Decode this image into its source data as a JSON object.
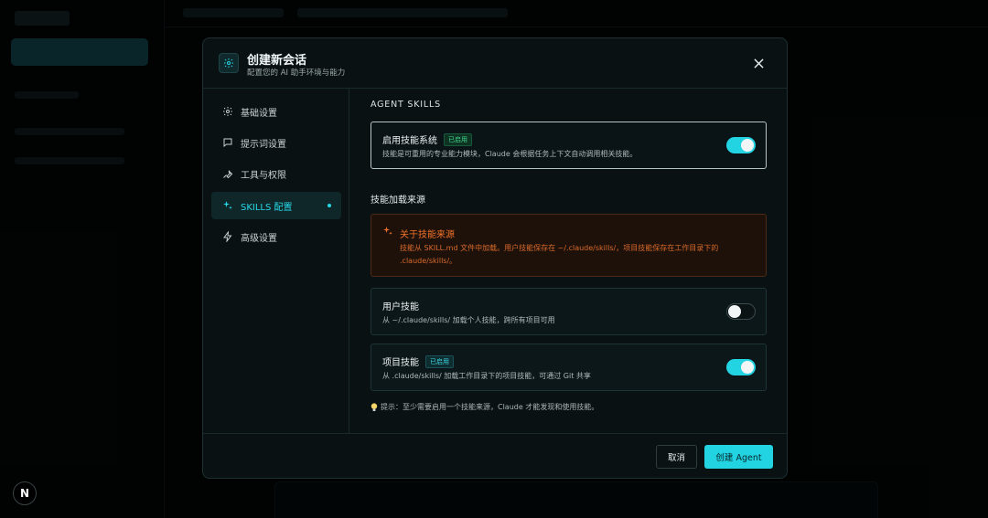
{
  "modal": {
    "title": "创建新会话",
    "subtitle": "配置您的 AI 助手环境与能力",
    "header_icon": "gear-icon",
    "close_icon": "close-icon"
  },
  "nav": {
    "items": [
      {
        "label": "基础设置",
        "icon": "gear-icon",
        "active": false
      },
      {
        "label": "提示词设置",
        "icon": "chat-bubble-icon",
        "active": false
      },
      {
        "label": "工具与权限",
        "icon": "wrench-icon",
        "active": false
      },
      {
        "label": "SKILLS 配置",
        "icon": "sparkles-icon",
        "active": true
      },
      {
        "label": "高级设置",
        "icon": "lightning-icon",
        "active": false
      }
    ]
  },
  "skills": {
    "section_title": "AGENT SKILLS",
    "enable_card": {
      "title": "启用技能系统",
      "badge": "已启用",
      "description": "技能是可重用的专业能力模块，Claude 会根据任务上下文自动调用相关技能。",
      "enabled": true
    },
    "sources_heading": "技能加载来源",
    "info": {
      "icon": "sparkles-icon",
      "title": "关于技能来源",
      "text": "技能从 SKILL.md 文件中加载。用户技能保存在 ~/.claude/skills/，项目技能保存在工作目录下的 .claude/skills/。"
    },
    "user_skills": {
      "title": "用户技能",
      "description": "从 ~/.claude/skills/ 加载个人技能，跨所有项目可用",
      "enabled": false
    },
    "project_skills": {
      "title": "项目技能",
      "badge": "已启用",
      "description": "从 .claude/skills/ 加载工作目录下的项目技能，可通过 Git 共享",
      "enabled": true
    },
    "tip": "提示：至少需要启用一个技能来源，Claude 才能发现和使用技能。"
  },
  "footer": {
    "cancel_label": "取消",
    "create_label": "创建 Agent"
  },
  "corner_badge": "N",
  "colors": {
    "accent": "#22d3e2",
    "warning": "#f0722b",
    "success": "#3dd68c",
    "modal_bg": "#091112"
  }
}
